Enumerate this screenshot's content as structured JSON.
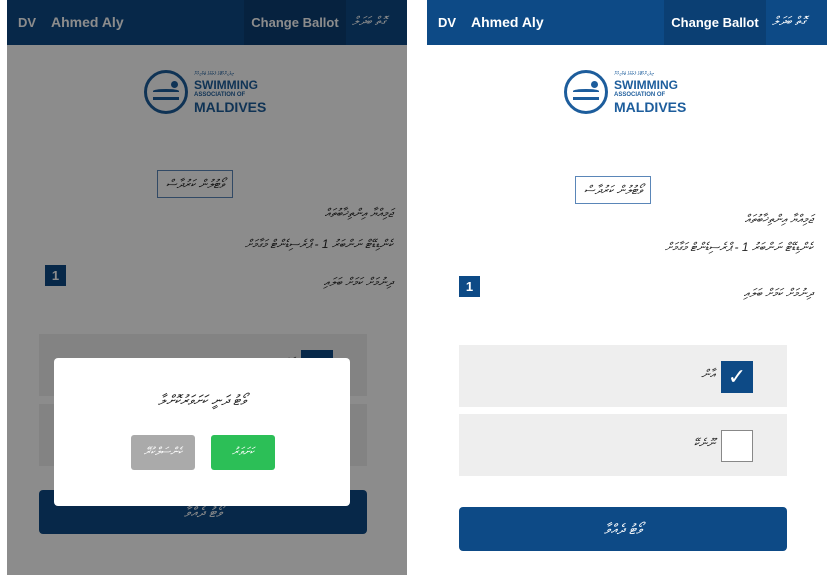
{
  "header": {
    "lang_code": "DV",
    "user_name": "Ahmed Aly",
    "change_ballot": "Change Ballot",
    "lang_toggle": "ގޮތް ބަދަލް"
  },
  "logo": {
    "tiny": "ދިވެހިރާއްޖޭގެ ފެތުމުގެ ޖަމްޢިއްޔާ",
    "line1": "SWIMMING",
    "line2": "ASSOCIATION OF",
    "line3": "MALDIVES"
  },
  "ballot": {
    "boxed_title": "ވޯޓުލުން ކަރުދާސް",
    "line1": "ޖަމިއްޔާ އިންތިޚާބުތައް",
    "line2": "ކެންޑިޑޭޓް ނަންބަރު 1 - ޕްރެސިޑެންޓް މަގާމަށް",
    "number": "1",
    "question": "ދިނުމަށް ކަމަށް ބަލައި"
  },
  "options": [
    {
      "label": "އާން",
      "checked": true
    },
    {
      "label": "ނޫނެކޭ",
      "checked": false
    }
  ],
  "vote_button": "ވޯޓު ދެއްވާ",
  "dialog": {
    "text": "ވޯޓު ދަނީ ކަށަވަރުކޮށްލާ",
    "cancel": "ކެންސަލްކުރޭ",
    "confirm": "ކަށަވަރު"
  },
  "colors": {
    "primary": "#0d4a86",
    "confirm_green": "#2cbf57",
    "cancel_gray": "#aaaaaa"
  }
}
